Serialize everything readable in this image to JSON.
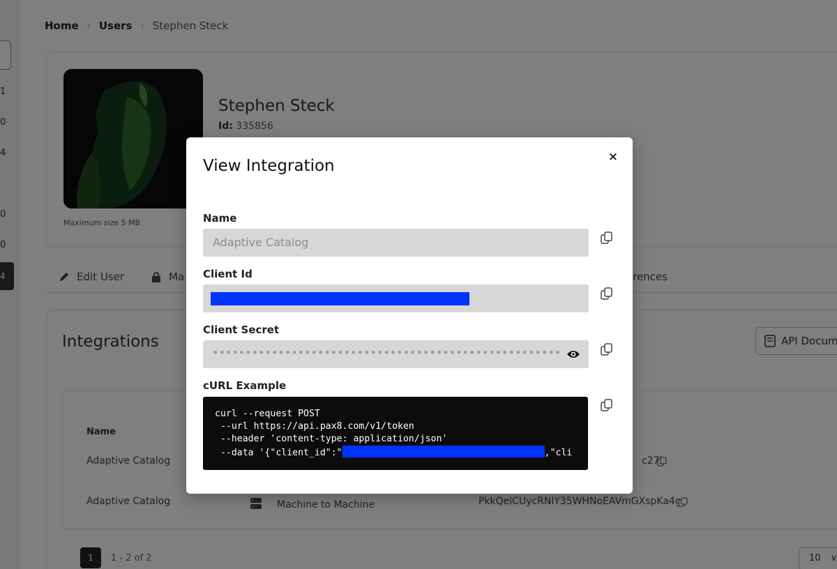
{
  "breadcrumb": {
    "home": "Home",
    "users": "Users",
    "current": "Stephen Steck"
  },
  "left_strip": {
    "numbers": [
      "1",
      "0",
      "4",
      "0",
      "0"
    ],
    "active": "4"
  },
  "profile": {
    "name": "Stephen Steck",
    "id_label": "Id:",
    "id_value": "335856",
    "avatar_hint": "Maximum size 5 MB"
  },
  "tabs": {
    "edit_user": "Edit User",
    "second": "Ma",
    "preferences": "erences"
  },
  "integrations": {
    "title": "Integrations",
    "api_doc_label": "API Docum",
    "column_name": "Name",
    "rows": [
      {
        "name": "Adaptive Catalog",
        "type": "",
        "client": "c27b"
      },
      {
        "name": "Adaptive Catalog",
        "type": "Machine to Machine",
        "client": "PkkQelCUycRNlY35WHNoEAVmGXspKa4g"
      }
    ],
    "pagination": {
      "page": "1",
      "info": "1 - 2 of 2",
      "per_page": "10"
    }
  },
  "modal": {
    "title": "View Integration",
    "close": "×",
    "name_label": "Name",
    "name_value": "Adaptive Catalog",
    "client_id_label": "Client Id",
    "client_secret_label": "Client Secret",
    "client_secret_mask": "••••••••••••••••••••••••••••••••••••••••••••••••••••••••••••••••",
    "curl_label": "cURL Example",
    "curl_lines": [
      "curl --request POST",
      " --url https://api.pax8.com/v1/token",
      " --header 'content-type: application/json'"
    ],
    "curl_data_prefix": " --data '{\"client_id\":\"",
    "curl_data_suffix": ",\"cli"
  },
  "colors": {
    "redaction": "#0033ff",
    "code_bg": "#0c0c0c",
    "field_bg": "#d7d7d7"
  }
}
